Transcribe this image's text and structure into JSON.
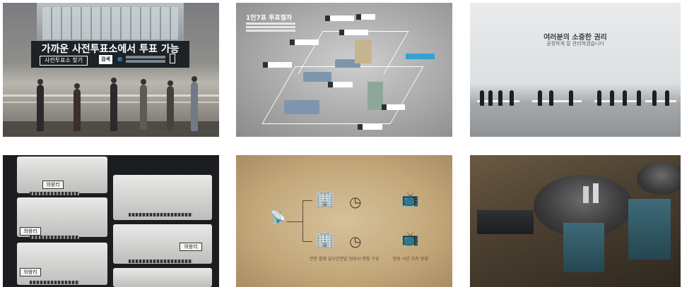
{
  "tile1": {
    "sign_title": "가까운 사전투표소에서 투표 가능",
    "sign_button_text": "사전투표소 찾기",
    "sign_badge": "검색",
    "sign_e": "e"
  },
  "tile2": {
    "title": "1인7표 투표절차"
  },
  "tile3": {
    "title": "여러분의 소중한 권리",
    "subtitle": "공정하게 잘 관리하겠습니다"
  },
  "tile4": {
    "tags": [
      "의왕리",
      "의왕리",
      "의왕리",
      "의왕리"
    ]
  },
  "tile5": {
    "captions": [
      "전방 촬영 실시간전달",
      "방송사 편집 구성",
      "방송 시간 모자 방영"
    ]
  },
  "colors": {
    "sign_bg": "#1d2227",
    "accent_blue": "#2a9fd6",
    "paper": "#c3a77a"
  }
}
